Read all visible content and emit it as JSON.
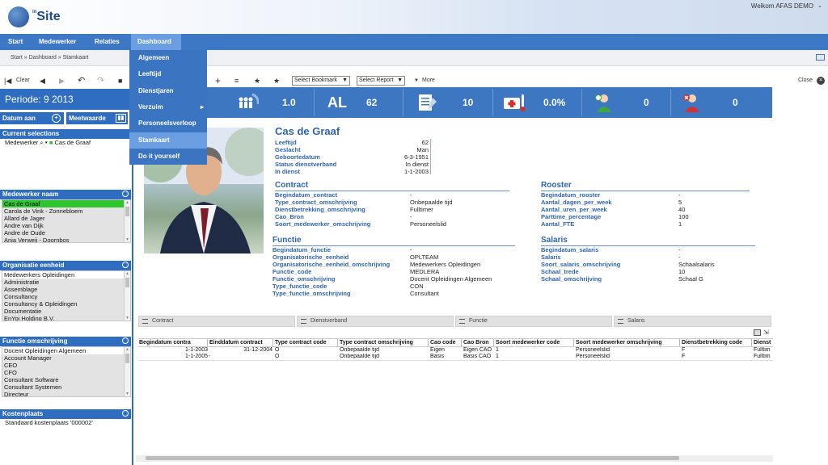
{
  "header": {
    "logo": "inSite",
    "logo_sup": "in",
    "welcome": "Welkom AFAS DEMO",
    "caret": "⌄"
  },
  "nav": {
    "items": [
      "Start",
      "Medewerker",
      "Relaties",
      "Dashboard"
    ]
  },
  "breadcrumb": "Start » Dashboard » Stamkaart",
  "toolbar": {
    "clear": "Clear",
    "bookmark": "Select Bookmark",
    "report": "Select Report",
    "more": "More",
    "close": "Close"
  },
  "sidebar": {
    "periode": "Periode: 9 2013",
    "datum_aan": "Datum aan",
    "meetwaarde": "Meetwaarde",
    "current_selections": "Current selections",
    "current_line": "Medewerker",
    "current_value": "Cas de Graaf",
    "sections": [
      {
        "title": "Medewerker naam",
        "items": [
          "Cas de Graaf",
          "Carola de Vink - Zonnebloem",
          "Allard de Jager",
          "Andre van Dijk",
          "Andre de Oude",
          "Anja Verweij - Doornbos"
        ]
      },
      {
        "title": "Organisatie eenheid",
        "items": [
          "Medewerkers Opleidingen",
          "Administratie",
          "Assemblage",
          "Consultancy",
          "Consultancy & Opleidingen",
          "Documentatie",
          "EnYoi Holding B.V."
        ]
      },
      {
        "title": "Functie omschrijving",
        "items": [
          "Docent Opleidingen Algemeen",
          "Account Manager",
          "CEO",
          "CFO",
          "Consultant Software",
          "Consultant Systemen",
          "Directeur"
        ]
      },
      {
        "title": "Kostenplaats",
        "items": [
          "Standaard kostenplaats '000002'"
        ]
      }
    ]
  },
  "dropdown": [
    "Algemeen",
    "Leeftijd",
    "Dienstjaren",
    "Verzuim",
    "Personeelsverloop",
    "Stamkaart",
    "Do it yourself"
  ],
  "stats": [
    "1.0",
    "AL",
    "62",
    "10",
    "0.0%",
    "0",
    "0"
  ],
  "employee": {
    "name": "Cas de Graaf",
    "basic": [
      [
        "Leeftijd",
        "62"
      ],
      [
        "Geslacht",
        "Man"
      ],
      [
        "Geboortedatum",
        "6-3-1951"
      ],
      [
        "Status dienstverband",
        "In dienst"
      ],
      [
        "In dienst",
        "1-1-2003"
      ]
    ],
    "contract_title": "Contract",
    "contract": [
      [
        "Begindatum_contract",
        "-"
      ],
      [
        "Type_contract_omschrijving",
        "Onbepaalde tijd"
      ],
      [
        "Dienstbetrekking_omschrijving",
        "Fulltimer"
      ],
      [
        "Cao_Bron",
        "-"
      ],
      [
        "Soort_medewerker_omschrijving",
        "Personeelslid"
      ]
    ],
    "rooster_title": "Rooster",
    "rooster": [
      [
        "Begindatum_rooster",
        "-"
      ],
      [
        "Aantal_dagen_per_week",
        "5"
      ],
      [
        "Aantal_uren_per_week",
        "40"
      ],
      [
        "Parttime_percentage",
        "100"
      ],
      [
        "Aantal_FTE",
        "1"
      ]
    ],
    "functie_title": "Functie",
    "functie": [
      [
        "Begindatum_functie",
        "-"
      ],
      [
        "Organisatorische_eenheid",
        "OPLTEAM"
      ],
      [
        "Organisatorische_eenheid_omschrijving",
        "Medewerkers Opleidingen"
      ],
      [
        "Functie_code",
        "MEDLERA"
      ],
      [
        "Functie_omschrijving",
        "Docent Opleidingen Algemeen"
      ],
      [
        "Type_functie_code",
        "CON"
      ],
      [
        "Type_functie_omschrijving",
        "Consultant"
      ]
    ],
    "salaris_title": "Salaris",
    "salaris": [
      [
        "Begindatum_salaris",
        "-"
      ],
      [
        "Salaris",
        "-"
      ],
      [
        "Soort_salaris_omschrijving",
        "Schaalsalaris"
      ],
      [
        "Schaal_trede",
        "10"
      ],
      [
        "Schaal_omschrijving",
        "Schaal G"
      ]
    ]
  },
  "tabs": [
    "Contract",
    "Dienstverband",
    "Functie",
    "Salaris"
  ],
  "table": {
    "headers": [
      "Begindatum contra",
      "Einddatum contract",
      "Type contract code",
      "Type contract omschrijving",
      "Cao code",
      "Cao Bron",
      "Soort medewerker code",
      "Soort medewerker omschrijving",
      "Dienstbetrekking code",
      "Dienst"
    ],
    "rows": [
      [
        "1-1-2003",
        "31-12-2004",
        "O",
        "Onbepaalde tijd",
        "Eigen",
        "Eigen CAO",
        "1",
        "Personeelslid",
        "F",
        "Fulltim"
      ],
      [
        "1-1-2005",
        "-",
        "O",
        "Onbepaalde tijd",
        "Basis",
        "Basis CAO",
        "1",
        "Personeelslid",
        "F",
        "Fulltim"
      ]
    ]
  }
}
